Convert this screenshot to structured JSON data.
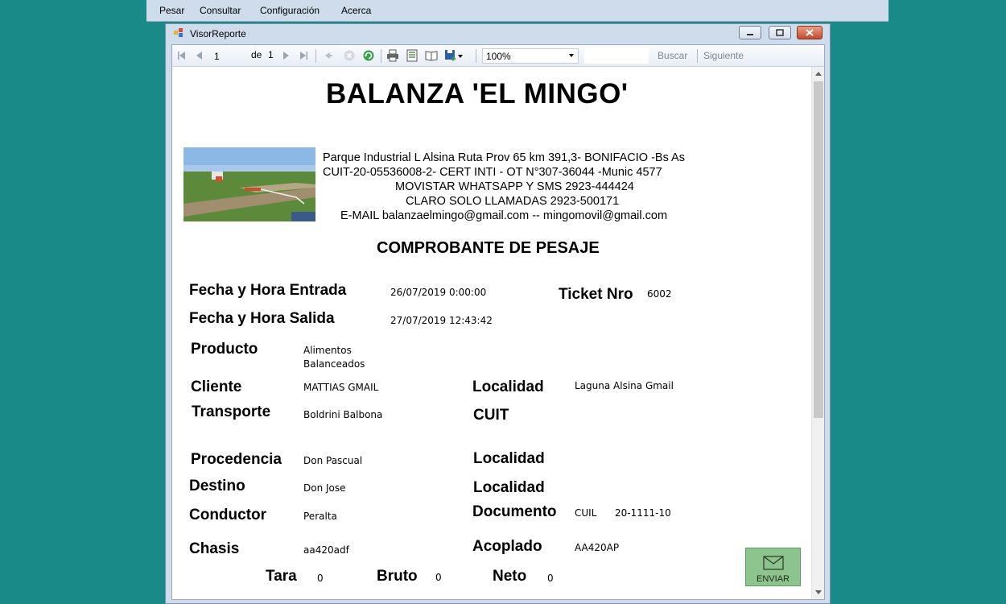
{
  "menu": {
    "items": [
      "Pesar",
      "Consultar",
      "Configuración",
      "Acerca"
    ]
  },
  "window": {
    "title": "VisorReporte"
  },
  "toolbar": {
    "page_current": "1",
    "page_of_label": "de",
    "page_total": "1",
    "zoom": "100%",
    "search_label": "Buscar",
    "next_label": "Siguiente"
  },
  "report": {
    "title": "BALANZA 'EL MINGO'",
    "info_lines": [
      "Parque Industrial L Alsina Ruta Prov 65 km 391,3- BONIFACIO -Bs As",
      "CUIT-20-05536008-2- CERT INTI - OT N°307-36044 -Munic 4577",
      "MOVISTAR WHATSAPP Y SMS 2923-444424",
      "CLARO SOLO LLAMADAS 2923-500171",
      "E-MAIL balanzaelmingo@gmail.com -- mingomovil@gmail.com"
    ],
    "subtitle": "COMPROBANTE DE PESAJE",
    "labels": {
      "fecha_entrada": "Fecha y Hora Entrada",
      "fecha_salida": "Fecha y Hora Salida",
      "ticket": "Ticket Nro",
      "producto": "Producto",
      "cliente": "Cliente",
      "localidad": "Localidad",
      "transporte": "Transporte",
      "cuit": "CUIT",
      "procedencia": "Procedencia",
      "destino": "Destino",
      "documento": "Documento",
      "conductor": "Conductor",
      "chasis": "Chasis",
      "acoplado": "Acoplado",
      "tara": "Tara",
      "bruto": "Bruto",
      "neto": "Neto"
    },
    "values": {
      "fecha_entrada": "26/07/2019 0:00:00",
      "fecha_salida": "27/07/2019 12:43:42",
      "ticket": "6002",
      "producto_line1": "Alimentos",
      "producto_line2": "Balanceados",
      "cliente": "MATTIAS GMAIL",
      "cliente_localidad": "Laguna Alsina Gmail",
      "transporte": "Boldrini Balbona",
      "procedencia": "Don Pascual",
      "destino": "Don Jose",
      "conductor": "Peralta",
      "documento_tipo": "CUIL",
      "documento_nro": "20-1111-10",
      "chasis": "aa420adf",
      "acoplado": "AA420AP",
      "tara": "0",
      "bruto": "0",
      "neto": "0"
    },
    "send_button": "ENVIAR"
  }
}
